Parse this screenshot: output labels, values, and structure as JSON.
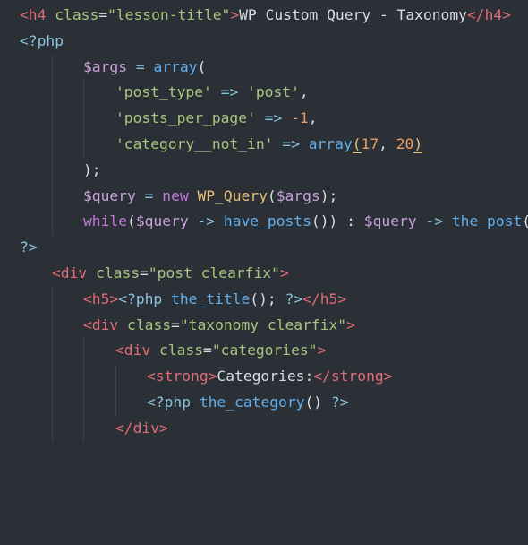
{
  "lines": [
    {
      "text": "<h4 class=\"lesson-title\">WP Custom Query - Taxonomy</h4>"
    },
    {
      "text": "<?php"
    },
    {
      "text": "$args = array("
    },
    {
      "text": "'post_type' => 'post',"
    },
    {
      "text": "'posts_per_page' => -1,"
    },
    {
      "text": "'category__not_in' => array(17, 20)"
    },
    {
      "text": ");"
    },
    {
      "text": "$query = new WP_Query($args);"
    },
    {
      "text": "while($query -> have_posts()) : $query -> the_post();"
    },
    {
      "text": "?>"
    },
    {
      "text": "<div class=\"post clearfix\">"
    },
    {
      "text": "<h5><?php the_title(); ?></h5>"
    },
    {
      "text": "<div class=\"taxonomy clearfix\">"
    },
    {
      "text": "<div class=\"categories\">"
    },
    {
      "text": "<strong>Categories:</strong>"
    },
    {
      "text": "<?php the_category() ?>"
    },
    {
      "text": "</div>"
    }
  ],
  "colors": {
    "background": "#2b3036",
    "tag": "#e06c75",
    "string": "#a9c47f",
    "function": "#61afef",
    "class": "#e5c07b",
    "number": "#e5a066"
  }
}
